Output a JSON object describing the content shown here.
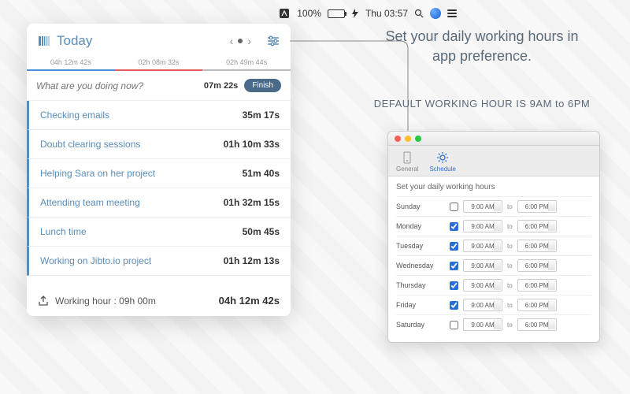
{
  "menubar": {
    "battery_pct": "100%",
    "clock": "Thu 03:57"
  },
  "popover": {
    "title": "Today",
    "segments": [
      {
        "label": "04h 12m 42s"
      },
      {
        "label": "02h 08m 32s"
      },
      {
        "label": "02h 49m 44s"
      }
    ],
    "input_placeholder": "What are you doing now?",
    "current_time": "07m 22s",
    "finish_label": "Finish",
    "tasks": [
      {
        "name": "Checking emails",
        "dur": "35m 17s"
      },
      {
        "name": "Doubt clearing sessions",
        "dur": "01h 10m 33s"
      },
      {
        "name": "Helping Sara on her project",
        "dur": "51m 40s"
      },
      {
        "name": "Attending team meeting",
        "dur": "01h 32m 15s"
      },
      {
        "name": "Lunch time",
        "dur": "50m 45s"
      },
      {
        "name": "Working on Jibto.io project",
        "dur": "01h 12m 13s"
      }
    ],
    "footer_label": "Working hour : 09h 00m",
    "footer_total": "04h 12m 42s"
  },
  "promo": {
    "headline": "Set your daily working hours in app preference.",
    "subhead": "DEFAULT WORKING HOUR IS 9AM to 6PM"
  },
  "pref": {
    "tabs": {
      "general": "General",
      "schedule": "Schedule"
    },
    "heading": "Set your daily working hours",
    "to": "to",
    "days": [
      {
        "name": "Sunday",
        "on": false,
        "from": "9:00 AM",
        "to": "6:00 PM"
      },
      {
        "name": "Monday",
        "on": true,
        "from": "9:00 AM",
        "to": "6:00 PM"
      },
      {
        "name": "Tuesday",
        "on": true,
        "from": "9:00 AM",
        "to": "6:00 PM"
      },
      {
        "name": "Wednesday",
        "on": true,
        "from": "9:00 AM",
        "to": "6:00 PM"
      },
      {
        "name": "Thursday",
        "on": true,
        "from": "9:00 AM",
        "to": "6:00 PM"
      },
      {
        "name": "Friday",
        "on": true,
        "from": "9:00 AM",
        "to": "6:00 PM"
      },
      {
        "name": "Saturday",
        "on": false,
        "from": "9:00 AM",
        "to": "6:00 PM"
      }
    ]
  }
}
